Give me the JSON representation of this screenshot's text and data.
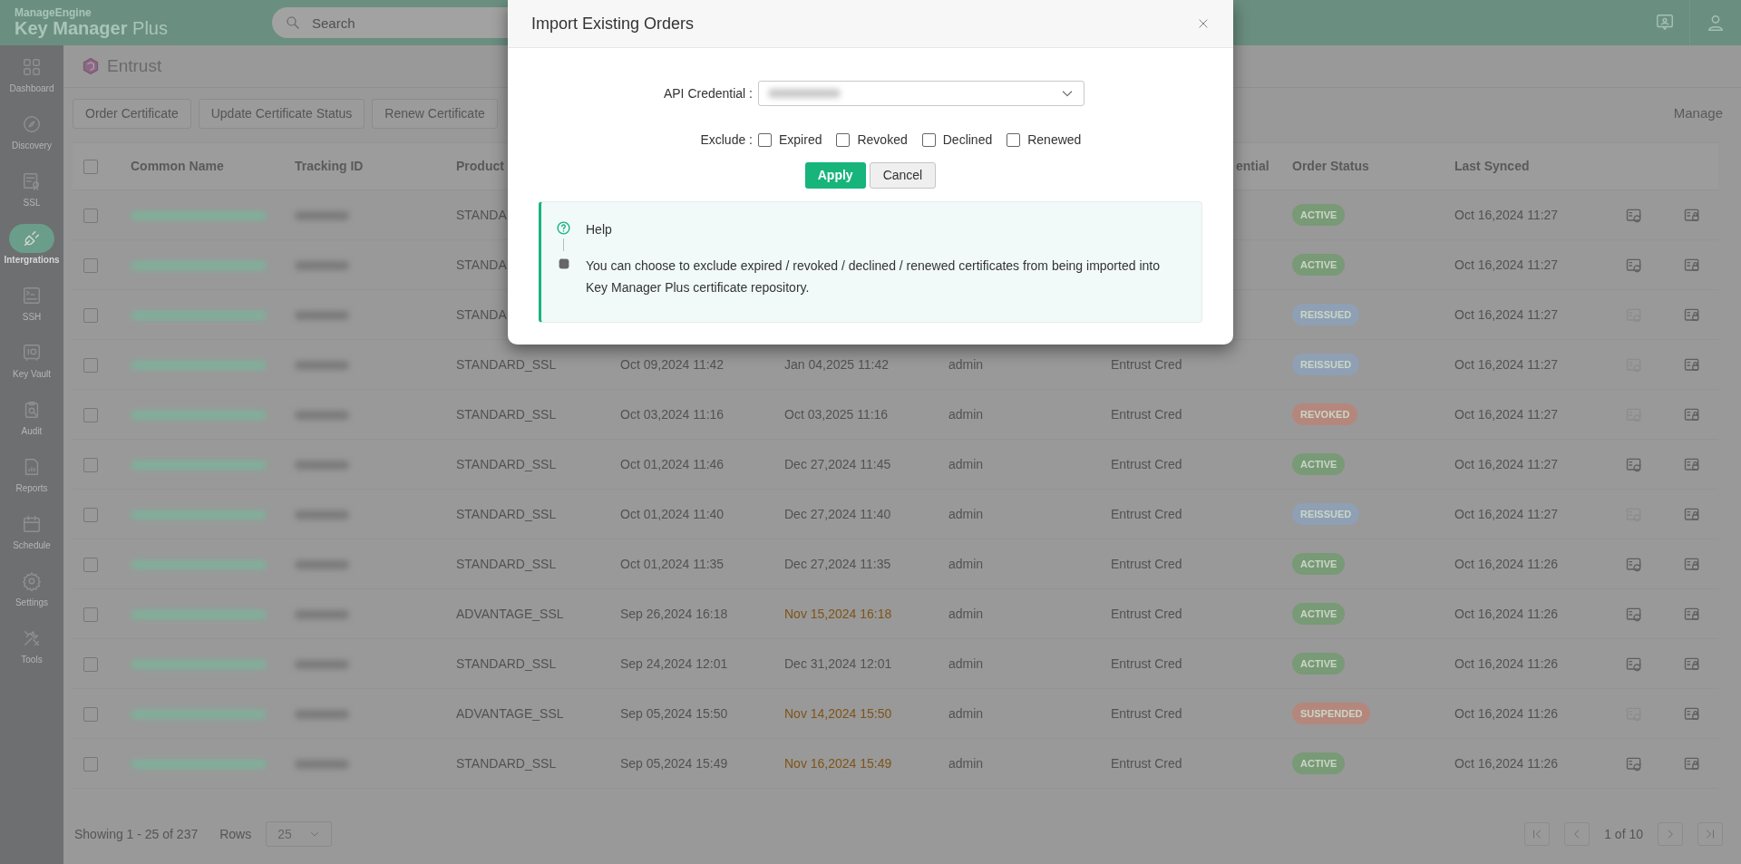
{
  "app": {
    "brand": "ManageEngine",
    "product": "Key Manager",
    "product_suffix": "Plus"
  },
  "search": {
    "placeholder": "Search"
  },
  "sidebar": {
    "items": [
      {
        "label": "Dashboard",
        "selected": false
      },
      {
        "label": "Discovery",
        "selected": false
      },
      {
        "label": "SSL",
        "selected": false
      },
      {
        "label": "Intergrations",
        "selected": true
      },
      {
        "label": "SSH",
        "selected": false
      },
      {
        "label": "Key Vault",
        "selected": false
      },
      {
        "label": "Audit",
        "selected": false
      },
      {
        "label": "Reports",
        "selected": false
      },
      {
        "label": "Schedule",
        "selected": false
      },
      {
        "label": "Settings",
        "selected": false
      },
      {
        "label": "Tools",
        "selected": false
      }
    ]
  },
  "page": {
    "title": "Entrust"
  },
  "toolbar": {
    "buttons": [
      "Order Certificate",
      "Update Certificate Status",
      "Renew Certificate"
    ],
    "manage": "Manage"
  },
  "table": {
    "all_checked": false,
    "columns": [
      {
        "label": "Common Name"
      },
      {
        "label": "Tracking ID"
      },
      {
        "label": "Product"
      },
      {},
      {},
      {},
      {
        "label": "ential"
      },
      {
        "label": "Order Status"
      },
      {
        "label": "Last Synced"
      },
      {},
      {}
    ],
    "rows": [
      {
        "checked": false,
        "product": "STANDA",
        "status": "ACTIVE",
        "color": "#789a76",
        "synced": "Oct 16,2024 11:27",
        "renew_enabled": true
      },
      {
        "checked": false,
        "product": "STANDA",
        "status": "ACTIVE",
        "color": "#789a76",
        "synced": "Oct 16,2024 11:27",
        "renew_enabled": true
      },
      {
        "checked": false,
        "product": "STANDA",
        "status": "REISSUED",
        "color": "#8fa0b5",
        "synced": "Oct 16,2024 11:27",
        "renew_enabled": false
      },
      {
        "checked": false,
        "product": "STANDARD_SSL",
        "created": "Oct 09,2024 11:42",
        "expires": "Jan 04,2025 11:42",
        "expiring_soon": false,
        "user": "admin",
        "credential": "Entrust Cred",
        "status": "REISSUED",
        "color": "#8fa0b5",
        "synced": "Oct 16,2024 11:27",
        "renew_enabled": false
      },
      {
        "checked": false,
        "product": "STANDARD_SSL",
        "created": "Oct 03,2024 11:16",
        "expires": "Oct 03,2025 11:16",
        "expiring_soon": false,
        "user": "admin",
        "credential": "Entrust Cred",
        "status": "REVOKED",
        "color": "#b5877c",
        "synced": "Oct 16,2024 11:27",
        "renew_enabled": false
      },
      {
        "checked": false,
        "product": "STANDARD_SSL",
        "created": "Oct 01,2024 11:46",
        "expires": "Dec 27,2024 11:45",
        "expiring_soon": false,
        "user": "admin",
        "credential": "Entrust Cred",
        "status": "ACTIVE",
        "color": "#789a76",
        "synced": "Oct 16,2024 11:27",
        "renew_enabled": true
      },
      {
        "checked": false,
        "product": "STANDARD_SSL",
        "created": "Oct 01,2024 11:40",
        "expires": "Dec 27,2024 11:40",
        "expiring_soon": false,
        "user": "admin",
        "credential": "Entrust Cred",
        "status": "REISSUED",
        "color": "#8fa0b5",
        "synced": "Oct 16,2024 11:27",
        "renew_enabled": false
      },
      {
        "checked": false,
        "product": "STANDARD_SSL",
        "created": "Oct 01,2024 11:35",
        "expires": "Dec 27,2024 11:35",
        "expiring_soon": false,
        "user": "admin",
        "credential": "Entrust Cred",
        "status": "ACTIVE",
        "color": "#789a76",
        "synced": "Oct 16,2024 11:26",
        "renew_enabled": true
      },
      {
        "checked": false,
        "product": "ADVANTAGE_SSL",
        "created": "Sep 26,2024 16:18",
        "expires": "Nov 15,2024 16:18",
        "expiring_soon": true,
        "user": "admin",
        "credential": "Entrust Cred",
        "status": "ACTIVE",
        "color": "#789a76",
        "synced": "Oct 16,2024 11:26",
        "renew_enabled": true
      },
      {
        "checked": false,
        "product": "STANDARD_SSL",
        "created": "Sep 24,2024 12:01",
        "expires": "Dec 31,2024 12:01",
        "expiring_soon": false,
        "user": "admin",
        "credential": "Entrust Cred",
        "status": "ACTIVE",
        "color": "#789a76",
        "synced": "Oct 16,2024 11:26",
        "renew_enabled": true
      },
      {
        "checked": false,
        "product": "ADVANTAGE_SSL",
        "created": "Sep 05,2024 15:50",
        "expires": "Nov 14,2024 15:50",
        "expiring_soon": true,
        "user": "admin",
        "credential": "Entrust Cred",
        "status": "SUSPENDED",
        "color": "#b5877c",
        "synced": "Oct 16,2024 11:26",
        "renew_enabled": false
      },
      {
        "checked": false,
        "product": "STANDARD_SSL",
        "created": "Sep 05,2024 15:49",
        "expires": "Nov 16,2024 15:49",
        "expiring_soon": true,
        "user": "admin",
        "credential": "Entrust Cred",
        "status": "ACTIVE",
        "color": "#789a76",
        "synced": "Oct 16,2024 11:26",
        "renew_enabled": true
      }
    ]
  },
  "footer": {
    "showing": "Showing 1 - 25 of 237",
    "rows_label": "Rows",
    "rows_value": "25",
    "page": "1 of 10"
  },
  "dialog": {
    "title": "Import Existing Orders",
    "credential_label": "API Credential",
    "exclude_label": "Exclude",
    "colon": ":",
    "options": [
      {
        "label": "Expired",
        "checked": false
      },
      {
        "label": "Revoked",
        "checked": false
      },
      {
        "label": "Declined",
        "checked": false
      },
      {
        "label": "Renewed",
        "checked": false
      }
    ],
    "apply": "Apply",
    "cancel": "Cancel",
    "help": {
      "title": "Help",
      "text": "You can choose to exclude expired / revoked / declined / renewed certificates from being imported into Key Manager Plus certificate repository."
    }
  }
}
